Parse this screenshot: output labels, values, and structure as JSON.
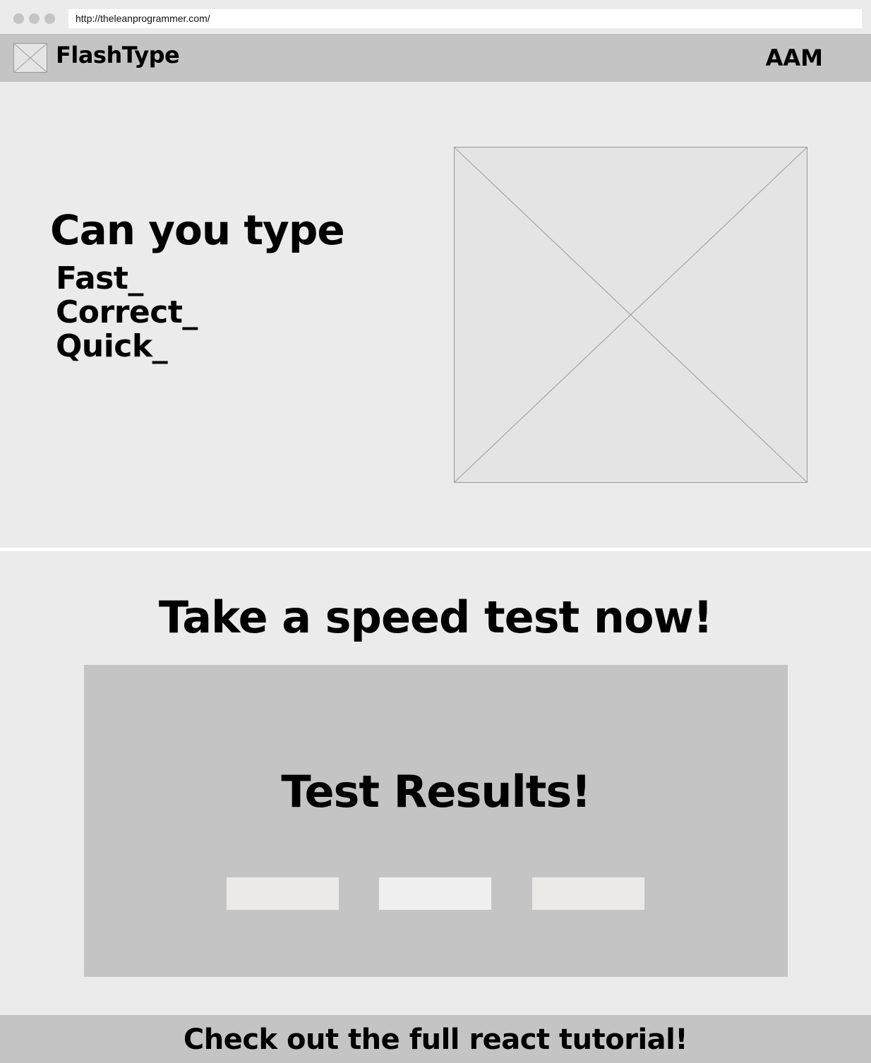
{
  "browser": {
    "url": "http://theleanprogrammer.com/"
  },
  "header": {
    "brand": "FlashType",
    "user_initials": "AAM",
    "logo_icon": "image-placeholder-icon"
  },
  "hero": {
    "title": "Can you type",
    "words": [
      "Fast_",
      "Correct_",
      "Quick_"
    ],
    "image_icon": "image-placeholder-icon"
  },
  "test": {
    "heading": "Take a speed test now!",
    "results_title": "Test Results!"
  },
  "footer": {
    "link_text": "Check out the full react tutorial!"
  },
  "colors": {
    "page_bg": "#ebebeb",
    "bar_bg": "#c4c4c4",
    "placeholder_bg": "#e4e4e4",
    "result_box_bg": "#ece9e9"
  }
}
